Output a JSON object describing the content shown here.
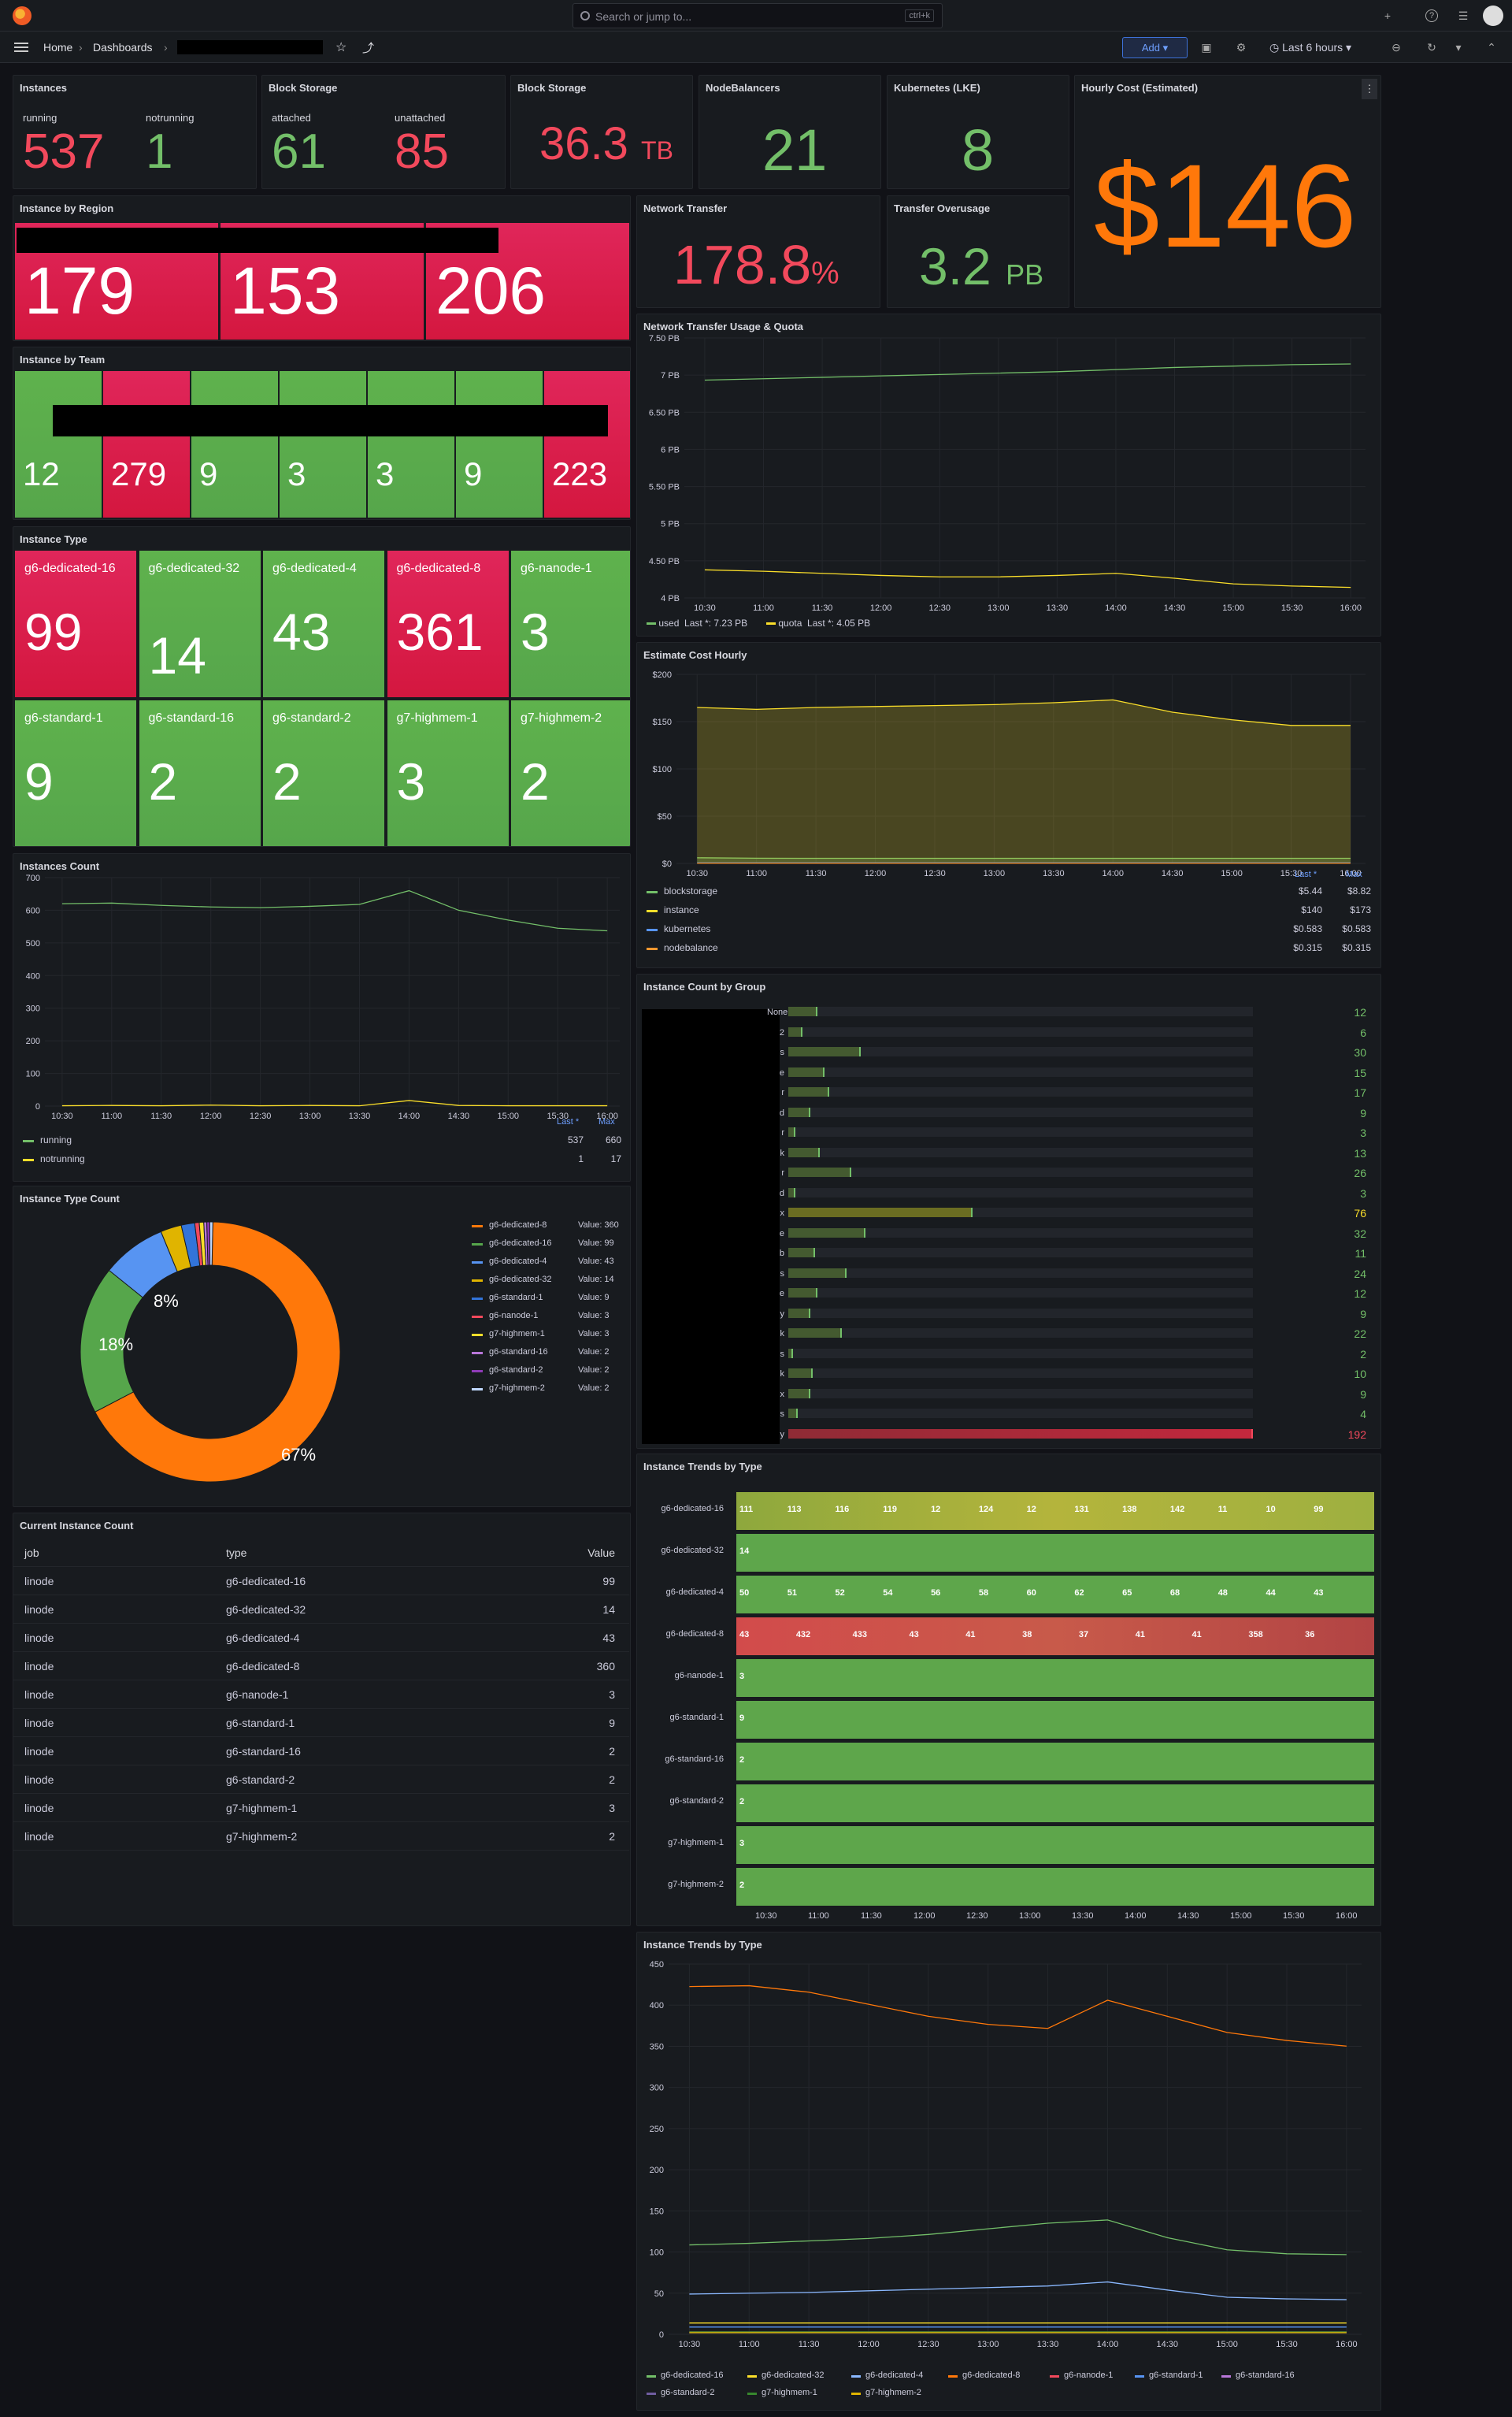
{
  "topbar": {
    "search_placeholder": "Search or jump to...",
    "search_shortcut": "ctrl+k",
    "plus": "+",
    "help": "?",
    "news": "☰"
  },
  "nav": {
    "home": "Home",
    "dashboards": "Dashboards",
    "add": "Add",
    "time_range": "Last 6 hours"
  },
  "panels": {
    "instances": {
      "title": "Instances",
      "running_label": "running",
      "running": "537",
      "notrunning_label": "notrunning",
      "notrunning": "1"
    },
    "block_storage_1": {
      "title": "Block Storage",
      "attached_label": "attached",
      "attached": "61",
      "unattached_label": "unattached",
      "unattached": "85"
    },
    "block_storage_2": {
      "title": "Block Storage",
      "value": "36.3",
      "unit": "TB"
    },
    "nodebalancers": {
      "title": "NodeBalancers",
      "value": "21"
    },
    "kubernetes": {
      "title": "Kubernetes (LKE)",
      "value": "8"
    },
    "hourly_cost": {
      "title": "Hourly Cost (Estimated)",
      "value": "$146"
    },
    "instance_by_region": {
      "title": "Instance by Region",
      "values": [
        "179",
        "153",
        "206"
      ]
    },
    "network_transfer": {
      "title": "Network Transfer",
      "value": "178.8",
      "unit": "%"
    },
    "transfer_overusage": {
      "title": "Transfer Overusage",
      "value": "3.2",
      "unit": "PB"
    },
    "instance_by_team": {
      "title": "Instance by Team",
      "values": [
        "12",
        "279",
        "9",
        "3",
        "3",
        "9",
        "223"
      ]
    },
    "instance_type": {
      "title": "Instance Type",
      "tiles": [
        {
          "label": "g6-dedicated-16",
          "value": "99",
          "color": "red"
        },
        {
          "label": "g6-dedicated-32",
          "value": "14",
          "color": "green"
        },
        {
          "label": "g6-dedicated-4",
          "value": "43",
          "color": "green"
        },
        {
          "label": "g6-dedicated-8",
          "value": "361",
          "color": "red"
        },
        {
          "label": "g6-nanode-1",
          "value": "3",
          "color": "green"
        },
        {
          "label": "g6-standard-1",
          "value": "9",
          "color": "green"
        },
        {
          "label": "g6-standard-16",
          "value": "2",
          "color": "green"
        },
        {
          "label": "g6-standard-2",
          "value": "2",
          "color": "green"
        },
        {
          "label": "g7-highmem-1",
          "value": "3",
          "color": "green"
        },
        {
          "label": "g7-highmem-2",
          "value": "2",
          "color": "green"
        }
      ]
    },
    "network_usage": {
      "title": "Network Transfer Usage & Quota",
      "legend": [
        {
          "name": "used",
          "last": "Last *: 7.23 PB"
        },
        {
          "name": "quota",
          "last": "Last *: 4.05 PB"
        }
      ]
    },
    "estimate_cost": {
      "title": "Estimate Cost Hourly",
      "hdr_last": "Last *",
      "hdr_max": "Max",
      "legend": [
        {
          "name": "blockstorage",
          "last": "$5.44",
          "max": "$8.82"
        },
        {
          "name": "instance",
          "last": "$140",
          "max": "$173"
        },
        {
          "name": "kubernetes",
          "last": "$0.583",
          "max": "$0.583"
        },
        {
          "name": "nodebalance",
          "last": "$0.315",
          "max": "$0.315"
        }
      ]
    },
    "instances_count": {
      "title": "Instances Count",
      "hdr_last": "Last *",
      "hdr_max": "Max",
      "legend": [
        {
          "name": "running",
          "last": "537",
          "max": "660"
        },
        {
          "name": "notrunning",
          "last": "1",
          "max": "17"
        }
      ]
    },
    "instance_count_group": {
      "title": "Instance Count by Group",
      "rows": [
        {
          "label": "None",
          "value": "12"
        },
        {
          "label": "2",
          "value": "6"
        },
        {
          "label": "s",
          "value": "30"
        },
        {
          "label": "e",
          "value": "15"
        },
        {
          "label": "r",
          "value": "17"
        },
        {
          "label": "d",
          "value": "9"
        },
        {
          "label": "r",
          "value": "3"
        },
        {
          "label": "k",
          "value": "13"
        },
        {
          "label": "r",
          "value": "26"
        },
        {
          "label": "d",
          "value": "3"
        },
        {
          "label": "x",
          "value": "76"
        },
        {
          "label": "e",
          "value": "32"
        },
        {
          "label": "b",
          "value": "11"
        },
        {
          "label": "s",
          "value": "24"
        },
        {
          "label": "e",
          "value": "12"
        },
        {
          "label": "y",
          "value": "9"
        },
        {
          "label": "k",
          "value": "22"
        },
        {
          "label": "s",
          "value": "2"
        },
        {
          "label": "k",
          "value": "10"
        },
        {
          "label": "x",
          "value": "9"
        },
        {
          "label": "s",
          "value": "4"
        },
        {
          "label": "y",
          "value": "192"
        }
      ]
    },
    "instance_type_count": {
      "title": "Instance Type Count",
      "slice_labels": [
        "67%",
        "18%",
        "8%"
      ],
      "legend": [
        {
          "name": "g6-dedicated-8",
          "value": "Value: 360"
        },
        {
          "name": "g6-dedicated-16",
          "value": "Value: 99"
        },
        {
          "name": "g6-dedicated-4",
          "value": "Value: 43"
        },
        {
          "name": "g6-dedicated-32",
          "value": "Value: 14"
        },
        {
          "name": "g6-standard-1",
          "value": "Value: 9"
        },
        {
          "name": "g6-nanode-1",
          "value": "Value: 3"
        },
        {
          "name": "g7-highmem-1",
          "value": "Value: 3"
        },
        {
          "name": "g6-standard-16",
          "value": "Value: 2"
        },
        {
          "name": "g6-standard-2",
          "value": "Value: 2"
        },
        {
          "name": "g7-highmem-2",
          "value": "Value: 2"
        }
      ]
    },
    "current_count": {
      "title": "Current Instance Count",
      "headers": [
        "job",
        "type",
        "Value"
      ],
      "rows": [
        [
          "linode",
          "g6-dedicated-16",
          "99"
        ],
        [
          "linode",
          "g6-dedicated-32",
          "14"
        ],
        [
          "linode",
          "g6-dedicated-4",
          "43"
        ],
        [
          "linode",
          "g6-dedicated-8",
          "360"
        ],
        [
          "linode",
          "g6-nanode-1",
          "3"
        ],
        [
          "linode",
          "g6-standard-1",
          "9"
        ],
        [
          "linode",
          "g6-standard-16",
          "2"
        ],
        [
          "linode",
          "g6-standard-2",
          "2"
        ],
        [
          "linode",
          "g7-highmem-1",
          "3"
        ],
        [
          "linode",
          "g7-highmem-2",
          "2"
        ]
      ]
    },
    "trends_state": {
      "title": "Instance Trends by Type",
      "rows": [
        {
          "label": "g6-dedicated-16",
          "values": [
            "111",
            "113",
            "116",
            "119",
            "12",
            "124",
            "12",
            "131",
            "138",
            "142",
            "11",
            "10",
            "99"
          ]
        },
        {
          "label": "g6-dedicated-32",
          "values": [
            "14"
          ]
        },
        {
          "label": "g6-dedicated-4",
          "values": [
            "50",
            "51",
            "52",
            "54",
            "56",
            "58",
            "60",
            "62",
            "65",
            "68",
            "48",
            "44",
            "43"
          ]
        },
        {
          "label": "g6-dedicated-8",
          "values": [
            "43",
            "432",
            "433",
            "43",
            "41",
            "38",
            "37",
            "41",
            "41",
            "358",
            "36"
          ]
        },
        {
          "label": "g6-nanode-1",
          "values": [
            "3"
          ]
        },
        {
          "label": "g6-standard-1",
          "values": [
            "9"
          ]
        },
        {
          "label": "g6-standard-16",
          "values": [
            "2"
          ]
        },
        {
          "label": "g6-standard-2",
          "values": [
            "2"
          ]
        },
        {
          "label": "g7-highmem-1",
          "values": [
            "3"
          ]
        },
        {
          "label": "g7-highmem-2",
          "values": [
            "2"
          ]
        }
      ]
    },
    "trends_line": {
      "title": "Instance Trends by Type",
      "legend": [
        "g6-dedicated-16",
        "g6-dedicated-32",
        "g6-dedicated-4",
        "g6-dedicated-8",
        "g6-nanode-1",
        "g6-standard-1",
        "g6-standard-16",
        "g6-standard-2",
        "g7-highmem-1",
        "g7-highmem-2"
      ]
    }
  },
  "time_ticks": [
    "10:30",
    "11:00",
    "11:30",
    "12:00",
    "12:30",
    "13:00",
    "13:30",
    "14:00",
    "14:30",
    "15:00",
    "15:30",
    "16:00"
  ],
  "chart_data": [
    {
      "type": "line",
      "title": "Network Transfer Usage & Quota",
      "ylabel": "",
      "ylim": [
        3.9,
        7.6
      ],
      "y_ticks": [
        "4 PB",
        "4.50 PB",
        "5 PB",
        "5.50 PB",
        "6 PB",
        "6.50 PB",
        "7 PB",
        "7.50 PB"
      ],
      "x": [
        "10:30",
        "11:00",
        "11:30",
        "12:00",
        "12:30",
        "13:00",
        "13:30",
        "14:00",
        "14:30",
        "15:00",
        "15:30",
        "16:00"
      ],
      "series": [
        {
          "name": "used",
          "color": "#73bf69",
          "values": [
            7.0,
            7.02,
            7.04,
            7.06,
            7.08,
            7.1,
            7.12,
            7.15,
            7.18,
            7.2,
            7.22,
            7.23
          ]
        },
        {
          "name": "quota",
          "color": "#fade2a",
          "values": [
            4.3,
            4.28,
            4.25,
            4.22,
            4.2,
            4.2,
            4.22,
            4.25,
            4.18,
            4.1,
            4.07,
            4.05
          ]
        }
      ]
    },
    {
      "type": "area",
      "title": "Estimate Cost Hourly",
      "ylim": [
        0,
        200
      ],
      "y_ticks": [
        "$0",
        "$50",
        "$100",
        "$150",
        "$200"
      ],
      "x": [
        "10:30",
        "11:00",
        "11:30",
        "12:00",
        "12:30",
        "13:00",
        "13:30",
        "14:00",
        "14:30",
        "15:00",
        "15:30",
        "16:00"
      ],
      "series": [
        {
          "name": "blockstorage",
          "color": "#73bf69",
          "values": [
            6,
            5.5,
            5.4,
            5.4,
            5.4,
            5.4,
            5.4,
            5.4,
            5.4,
            5.4,
            5.4,
            5.44
          ]
        },
        {
          "name": "instance",
          "color": "#fade2a",
          "values": [
            165,
            163,
            165,
            166,
            167,
            168,
            170,
            173,
            160,
            152,
            146,
            146
          ]
        },
        {
          "name": "kubernetes",
          "color": "#5794f2",
          "values": [
            0.6,
            0.6,
            0.6,
            0.6,
            0.6,
            0.6,
            0.6,
            0.6,
            0.6,
            0.6,
            0.6,
            0.6
          ]
        },
        {
          "name": "nodebalance",
          "color": "#ff9830",
          "values": [
            0.3,
            0.3,
            0.3,
            0.3,
            0.3,
            0.3,
            0.3,
            0.3,
            0.3,
            0.3,
            0.3,
            0.3
          ]
        }
      ]
    },
    {
      "type": "line",
      "title": "Instances Count",
      "ylim": [
        0,
        700
      ],
      "y_ticks": [
        "0",
        "100",
        "200",
        "300",
        "400",
        "500",
        "600",
        "700"
      ],
      "x": [
        "10:30",
        "11:00",
        "11:30",
        "12:00",
        "12:30",
        "13:00",
        "13:30",
        "14:00",
        "14:30",
        "15:00",
        "15:30",
        "16:00"
      ],
      "series": [
        {
          "name": "running",
          "color": "#73bf69",
          "values": [
            620,
            622,
            615,
            610,
            608,
            612,
            618,
            660,
            600,
            570,
            545,
            537
          ]
        },
        {
          "name": "notrunning",
          "color": "#fade2a",
          "values": [
            1,
            2,
            1,
            3,
            1,
            2,
            1,
            17,
            2,
            1,
            1,
            1
          ]
        }
      ]
    },
    {
      "type": "pie",
      "title": "Instance Type Count",
      "categories": [
        "g6-dedicated-8",
        "g6-dedicated-16",
        "g6-dedicated-4",
        "g6-dedicated-32",
        "g6-standard-1",
        "g6-nanode-1",
        "g7-highmem-1",
        "g6-standard-16",
        "g6-standard-2",
        "g7-highmem-2"
      ],
      "values": [
        360,
        99,
        43,
        14,
        9,
        3,
        3,
        2,
        2,
        2
      ],
      "colors": [
        "#ff780a",
        "#56a64b",
        "#5794f2",
        "#e0b400",
        "#3274d9",
        "#f2495c",
        "#fade2a",
        "#b877d9",
        "#8f3bb8",
        "#c0d8ff"
      ]
    },
    {
      "type": "line",
      "title": "Instance Trends by Type",
      "ylim": [
        0,
        460
      ],
      "y_ticks": [
        "0",
        "50",
        "100",
        "150",
        "200",
        "250",
        "300",
        "350",
        "400",
        "450"
      ],
      "x": [
        "10:30",
        "11:00",
        "11:30",
        "12:00",
        "12:30",
        "13:00",
        "13:30",
        "14:00",
        "14:30",
        "15:00",
        "15:30",
        "16:00"
      ],
      "series": [
        {
          "name": "g6-dedicated-16",
          "color": "#73bf69",
          "values": [
            111,
            113,
            116,
            119,
            124,
            131,
            138,
            142,
            120,
            105,
            100,
            99
          ]
        },
        {
          "name": "g6-dedicated-32",
          "color": "#fade2a",
          "values": [
            14,
            14,
            14,
            14,
            14,
            14,
            14,
            14,
            14,
            14,
            14,
            14
          ]
        },
        {
          "name": "g6-dedicated-4",
          "color": "#8ab8ff",
          "values": [
            50,
            51,
            52,
            54,
            56,
            58,
            60,
            65,
            55,
            46,
            44,
            43
          ]
        },
        {
          "name": "g6-dedicated-8",
          "color": "#ff780a",
          "values": [
            432,
            433,
            425,
            410,
            395,
            385,
            380,
            415,
            395,
            375,
            365,
            358
          ]
        },
        {
          "name": "g6-nanode-1",
          "color": "#f2495c",
          "values": [
            3,
            3,
            3,
            3,
            3,
            3,
            3,
            3,
            3,
            3,
            3,
            3
          ]
        },
        {
          "name": "g6-standard-1",
          "color": "#5794f2",
          "values": [
            9,
            9,
            9,
            9,
            9,
            9,
            9,
            9,
            9,
            9,
            9,
            9
          ]
        },
        {
          "name": "g6-standard-16",
          "color": "#b877d9",
          "values": [
            2,
            2,
            2,
            2,
            2,
            2,
            2,
            2,
            2,
            2,
            2,
            2
          ]
        },
        {
          "name": "g6-standard-2",
          "color": "#705da0",
          "values": [
            2,
            2,
            2,
            2,
            2,
            2,
            2,
            2,
            2,
            2,
            2,
            2
          ]
        },
        {
          "name": "g7-highmem-1",
          "color": "#37872d",
          "values": [
            3,
            3,
            3,
            3,
            3,
            3,
            3,
            3,
            3,
            3,
            3,
            3
          ]
        },
        {
          "name": "g7-highmem-2",
          "color": "#e0b400",
          "values": [
            2,
            2,
            2,
            2,
            2,
            2,
            2,
            2,
            2,
            2,
            2,
            2
          ]
        }
      ]
    }
  ]
}
